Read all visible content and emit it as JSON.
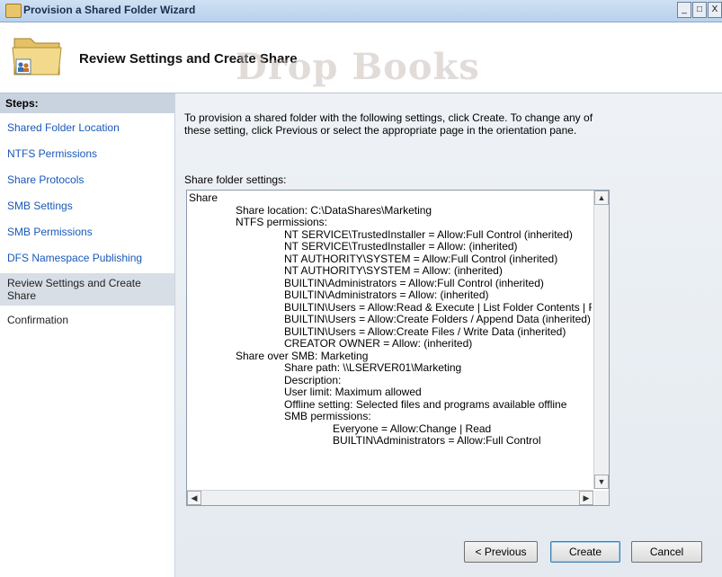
{
  "window": {
    "title": "Provision a Shared Folder Wizard",
    "buttons": [
      "_",
      "□",
      "X"
    ]
  },
  "header": {
    "title": "Review Settings and Create Share",
    "icon": "shared-folder-icon",
    "watermark": "Drop Books"
  },
  "steps": {
    "heading": "Steps:",
    "items": [
      {
        "label": "Shared Folder Location",
        "state": "done"
      },
      {
        "label": "NTFS Permissions",
        "state": "done"
      },
      {
        "label": "Share Protocols",
        "state": "done"
      },
      {
        "label": "SMB Settings",
        "state": "done"
      },
      {
        "label": "SMB Permissions",
        "state": "done"
      },
      {
        "label": "DFS Namespace Publishing",
        "state": "done"
      },
      {
        "label": "Review Settings and Create Share",
        "state": "current"
      },
      {
        "label": "Confirmation",
        "state": "pending"
      }
    ]
  },
  "main": {
    "intro": "To provision a shared folder with the following settings, click Create. To change any of these setting, click Previous or select the appropriate page in the orientation pane.",
    "settings_label": "Share folder settings:",
    "settings_lines": [
      {
        "indent": 0,
        "text": "Share"
      },
      {
        "indent": 1,
        "text": "Share location: C:\\DataShares\\Marketing"
      },
      {
        "indent": 1,
        "text": "NTFS permissions:"
      },
      {
        "indent": 2,
        "text": "NT SERVICE\\TrustedInstaller = Allow:Full Control (inherited)"
      },
      {
        "indent": 2,
        "text": "NT SERVICE\\TrustedInstaller = Allow: (inherited)"
      },
      {
        "indent": 2,
        "text": "NT AUTHORITY\\SYSTEM = Allow:Full Control (inherited)"
      },
      {
        "indent": 2,
        "text": "NT AUTHORITY\\SYSTEM = Allow: (inherited)"
      },
      {
        "indent": 2,
        "text": "BUILTIN\\Administrators = Allow:Full Control (inherited)"
      },
      {
        "indent": 2,
        "text": "BUILTIN\\Administrators = Allow: (inherited)"
      },
      {
        "indent": 2,
        "text": "BUILTIN\\Users = Allow:Read & Execute | List Folder Contents | F"
      },
      {
        "indent": 2,
        "text": "BUILTIN\\Users = Allow:Create Folders / Append Data (inherited)"
      },
      {
        "indent": 2,
        "text": "BUILTIN\\Users = Allow:Create Files / Write Data (inherited)"
      },
      {
        "indent": 2,
        "text": "CREATOR OWNER = Allow: (inherited)"
      },
      {
        "indent": 1,
        "text": "Share over SMB: Marketing"
      },
      {
        "indent": 2,
        "text": "Share path: \\\\LSERVER01\\Marketing"
      },
      {
        "indent": 2,
        "text": "Description:"
      },
      {
        "indent": 2,
        "text": "User limit: Maximum allowed"
      },
      {
        "indent": 2,
        "text": "Offline setting: Selected files and programs available offline"
      },
      {
        "indent": 2,
        "text": "SMB permissions:"
      },
      {
        "indent": 3,
        "text": "Everyone = Allow:Change | Read"
      },
      {
        "indent": 3,
        "text": "BUILTIN\\Administrators = Allow:Full Control"
      }
    ]
  },
  "footer": {
    "previous": "< Previous",
    "create": "Create",
    "cancel": "Cancel"
  }
}
